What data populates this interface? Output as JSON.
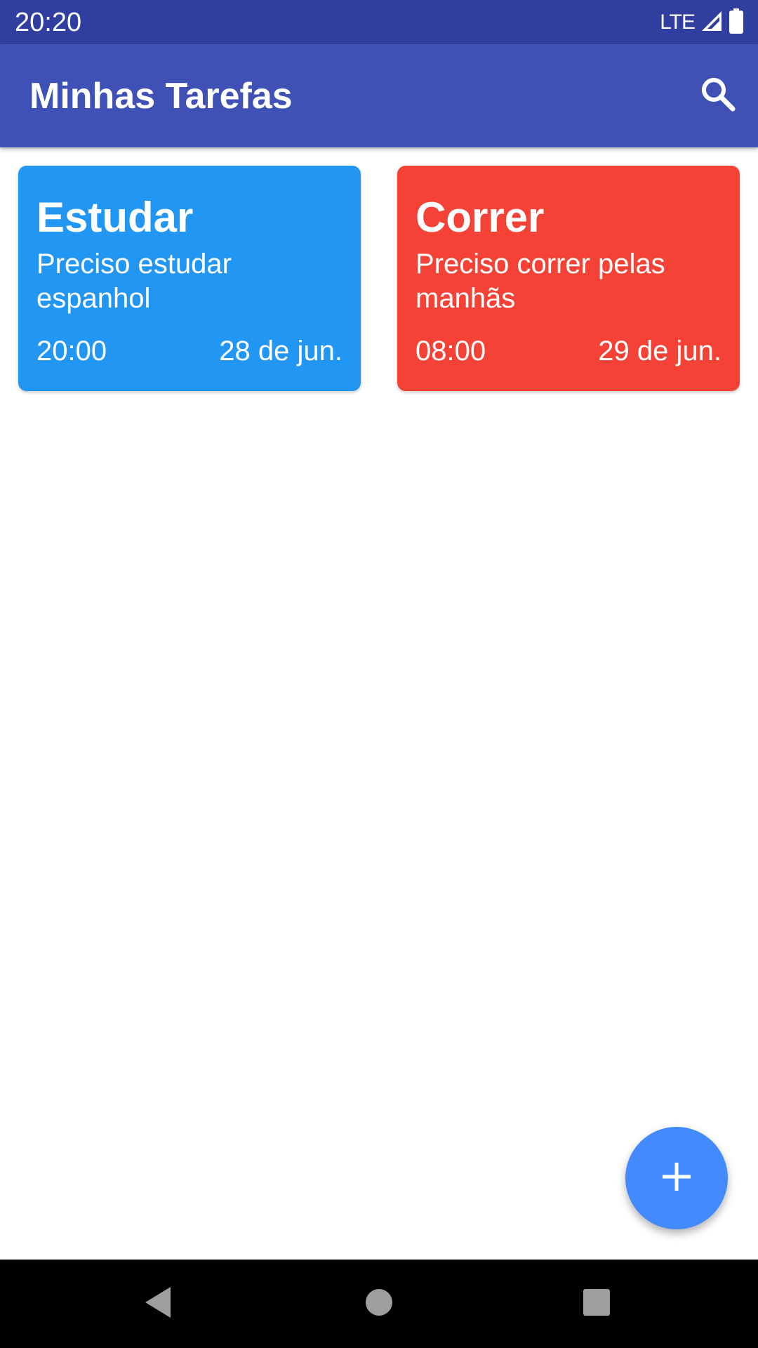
{
  "status_bar": {
    "time": "20:20",
    "network": "LTE",
    "icons": [
      "signal-icon",
      "battery-icon"
    ]
  },
  "app_bar": {
    "title": "Minhas Tarefas",
    "search_icon": "search-icon"
  },
  "tasks": [
    {
      "title": "Estudar",
      "description": "Preciso estudar espanhol",
      "time": "20:00",
      "date": "28 de jun.",
      "color": "#2196F3"
    },
    {
      "title": "Correr",
      "description": "Preciso correr pelas manhãs",
      "time": "08:00",
      "date": "29 de jun.",
      "color": "#F44336"
    }
  ],
  "fab": {
    "icon": "plus-icon",
    "color": "#448AFF"
  },
  "nav_bar": {
    "icons": [
      "back-icon",
      "home-icon",
      "recents-icon"
    ]
  },
  "colors": {
    "status_bar": "#303F9F",
    "app_bar": "#3F51B5"
  }
}
